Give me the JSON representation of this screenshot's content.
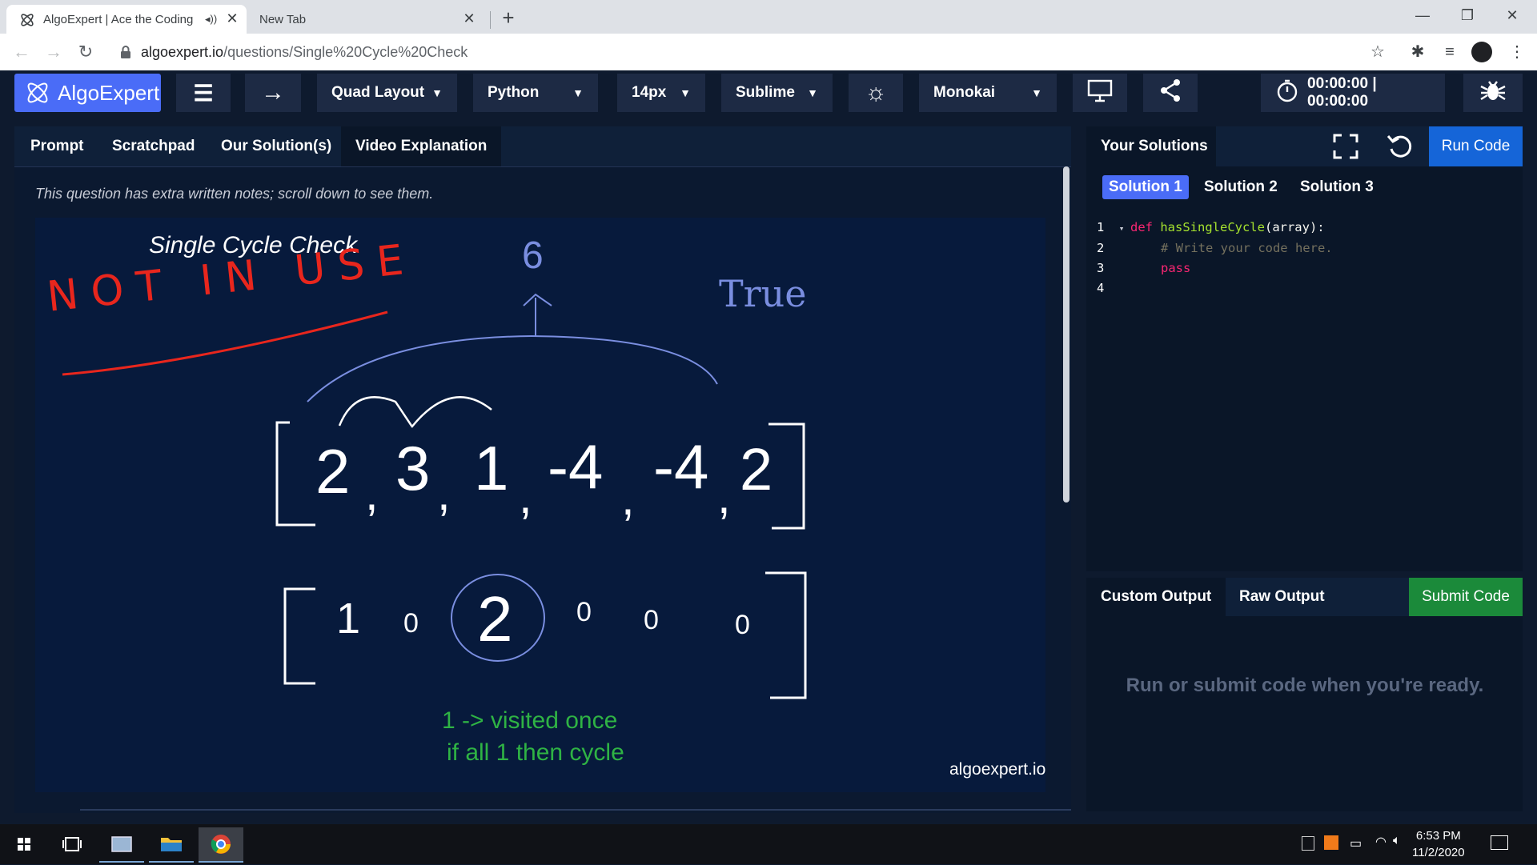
{
  "browser": {
    "tabs": [
      {
        "title": "AlgoExpert | Ace the Coding Interviews",
        "active": true
      },
      {
        "title": "New Tab",
        "active": false
      }
    ],
    "url_host": "algoexpert.io",
    "url_path": "/questions/Single%20Cycle%20Check"
  },
  "appbar": {
    "logo_text": "AlgoExpert",
    "layout": "Quad Layout",
    "language": "Python",
    "font_size": "14px",
    "keymap": "Sublime",
    "theme": "Monokai",
    "timer": "00:00:00 | 00:00:00"
  },
  "left_panel": {
    "tabs": [
      "Prompt",
      "Scratchpad",
      "Our Solution(s)",
      "Video Explanation"
    ],
    "active_tab": "Video Explanation",
    "notes": "This question has extra written notes; scroll down to see them.",
    "video": {
      "title": "Single Cycle Check",
      "stamp": "NOT IN USE",
      "top_value": "6",
      "result": "True",
      "array": [
        "2",
        "3",
        "1",
        "-4",
        "-4",
        "2"
      ],
      "visited": [
        "1",
        "0",
        "2",
        "0",
        "0",
        "0"
      ],
      "note_line1": "1 -> visited once",
      "note_line2": "if all 1 then cycle",
      "watermark": "algoexpert.io"
    }
  },
  "editor": {
    "title": "Your Solutions",
    "run_label": "Run Code",
    "solution_tabs": [
      "Solution 1",
      "Solution 2",
      "Solution 3"
    ],
    "active_solution": "Solution 1",
    "lines": [
      {
        "n": "1",
        "kw": "def ",
        "fn": "hasSingleCycle",
        "rest": "(array):"
      },
      {
        "n": "2",
        "comment": "# Write your code here."
      },
      {
        "n": "3",
        "kw": "pass"
      },
      {
        "n": "4"
      }
    ]
  },
  "output": {
    "tabs": [
      "Custom Output",
      "Raw Output"
    ],
    "submit_label": "Submit Code",
    "message": "Run or submit code when you're ready."
  },
  "taskbar": {
    "time": "6:53 PM",
    "date": "11/2/2020"
  }
}
